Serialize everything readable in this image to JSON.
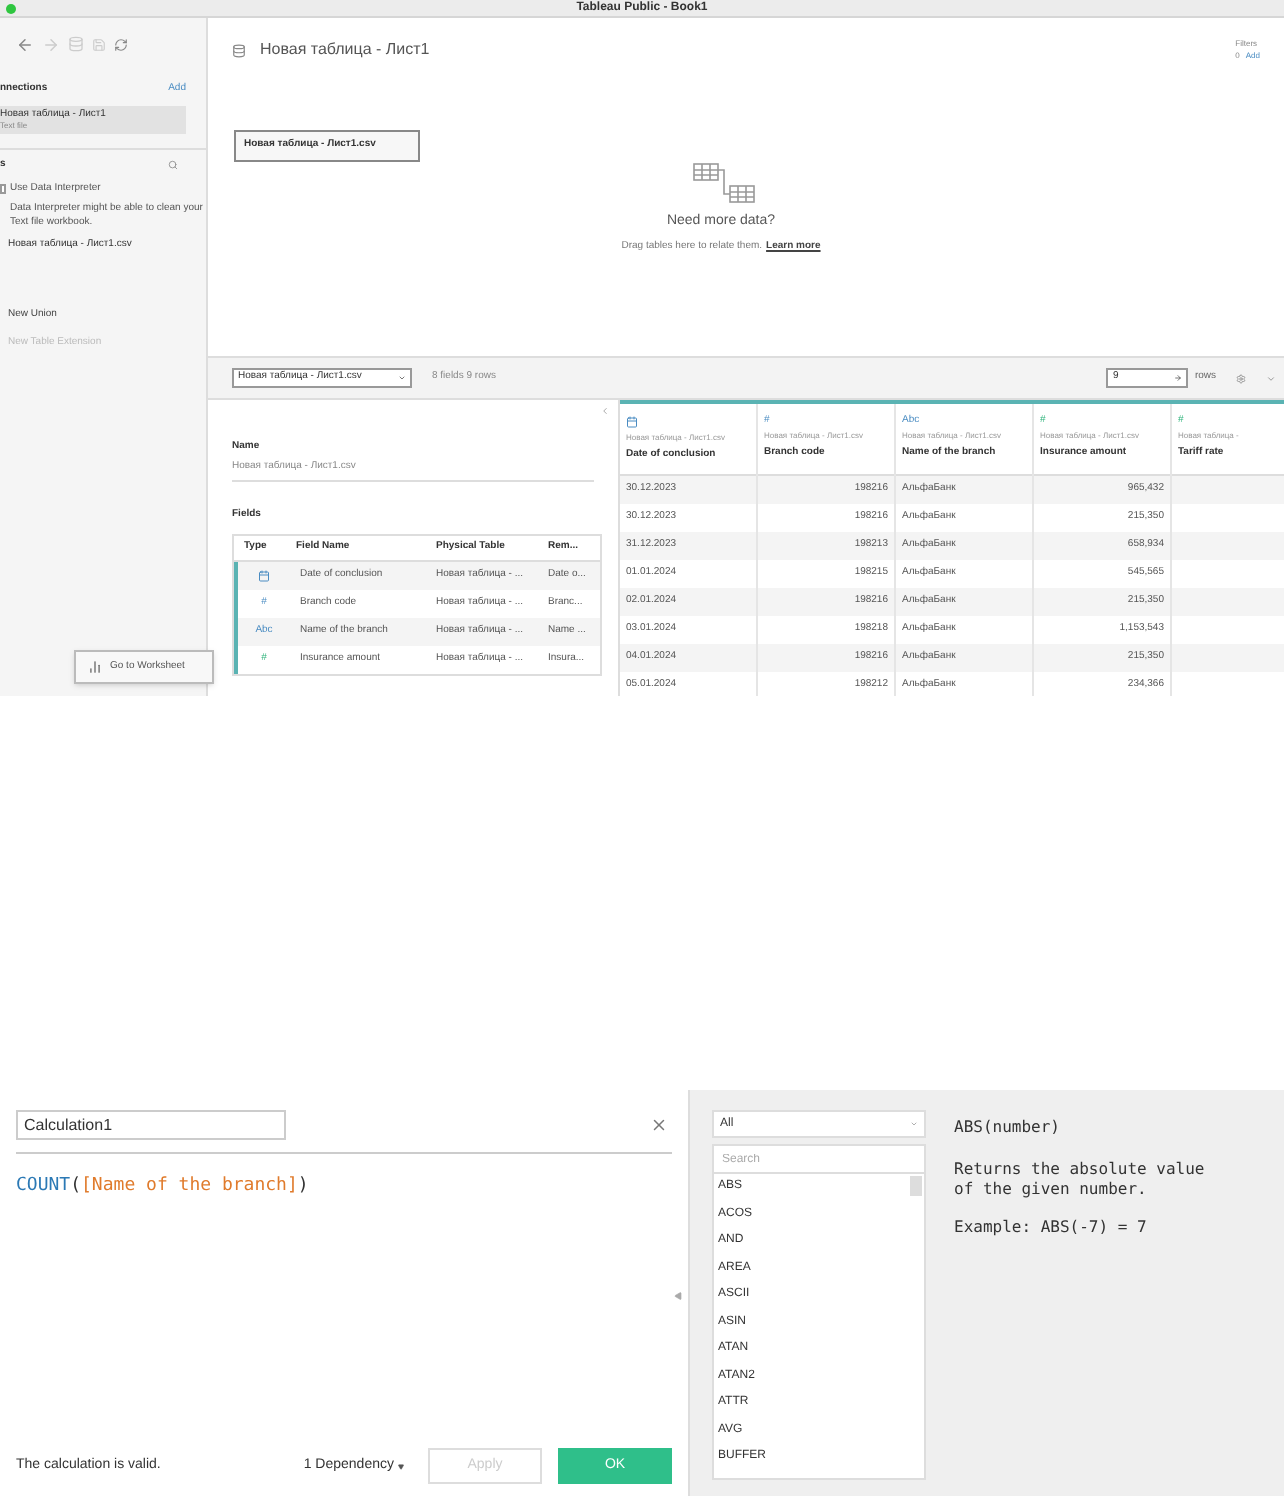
{
  "window": {
    "title": "Tableau Public - Book1"
  },
  "sidebar": {
    "connections_heading": "nnections",
    "add_link": "Add",
    "connection": {
      "name": "Новая таблица - Лист1",
      "type": "Text file"
    },
    "tables_heading": "s",
    "data_interpreter": {
      "label": "Use Data Interpreter",
      "checked": false,
      "hint": "Data Interpreter might be able to clean your Text file workbook."
    },
    "tables": [
      "Новая таблица - Лист1.csv"
    ],
    "actions": [
      {
        "label": "New Union",
        "disabled": false
      },
      {
        "label": "New Table Extension",
        "disabled": true
      }
    ]
  },
  "canvas": {
    "title": "Новая таблица - Лист1",
    "filters": {
      "label": "Filters",
      "count": "0",
      "add": "Add"
    },
    "table_box": "Новая таблица - Лист1.csv",
    "empty_title": "Need more data?",
    "empty_text": "Drag tables here to relate them.",
    "link": "Learn more"
  },
  "tooltip": {
    "label": "Go to Worksheet"
  },
  "grid_toolbar": {
    "table_select": "Новая таблица - Лист1.csv",
    "summary": "8 fields 9 rows",
    "rows_value": "9",
    "rows_label": "rows"
  },
  "metadata": {
    "name_label": "Name",
    "name_value": "Новая таблица - Лист1.csv",
    "fields_label": "Fields",
    "columns": [
      "Type",
      "Field Name",
      "Physical Table",
      "Rem..."
    ],
    "rows": [
      {
        "kind": "date",
        "field": "Date of conclusion",
        "table": "Новая таблица - ...",
        "remote": "Date o..."
      },
      {
        "kind": "number",
        "glyph": "#",
        "field": "Branch code",
        "table": "Новая таблица - ...",
        "remote": "Branc..."
      },
      {
        "kind": "string",
        "glyph": "Abc",
        "field": "Name of the branch",
        "table": "Новая таблица - ...",
        "remote": "Name ..."
      },
      {
        "kind": "measure",
        "glyph": "#",
        "field": "Insurance amount",
        "table": "Новая таблица - ...",
        "remote": "Insura..."
      }
    ]
  },
  "grid": {
    "columns": [
      {
        "kind": "date",
        "source": "Новая таблица - Лист1.csv",
        "name": "Date of conclusion"
      },
      {
        "kind": "number",
        "glyph": "#",
        "source": "Новая таблица - Лист1.csv",
        "name": "Branch code"
      },
      {
        "kind": "string",
        "glyph": "Abc",
        "source": "Новая таблица - Лист1.csv",
        "name": "Name of the branch"
      },
      {
        "kind": "measure",
        "glyph": "#",
        "source": "Новая таблица - Лист1.csv",
        "name": "Insurance amount"
      },
      {
        "kind": "measure",
        "glyph": "#",
        "source": "Новая таблица -",
        "name": "Tariff rate"
      }
    ],
    "rows": [
      [
        "30.12.2023",
        "198216",
        "АльфаБанк",
        "965,432"
      ],
      [
        "30.12.2023",
        "198216",
        "АльфаБанк",
        "215,350"
      ],
      [
        "31.12.2023",
        "198213",
        "АльфаБанк",
        "658,934"
      ],
      [
        "01.01.2024",
        "198215",
        "АльфаБанк",
        "545,565"
      ],
      [
        "02.01.2024",
        "198216",
        "АльфаБанк",
        "215,350"
      ],
      [
        "03.01.2024",
        "198218",
        "АльфаБанк",
        "1,153,543"
      ],
      [
        "04.01.2024",
        "198216",
        "АльфаБанк",
        "215,350"
      ],
      [
        "05.01.2024",
        "198212",
        "АльфаБанк",
        "234,366"
      ]
    ]
  },
  "calc": {
    "name": "Calculation1",
    "formula": {
      "function": "COUNT",
      "open": "(",
      "field": "[Name of the branch]",
      "close": ")"
    },
    "status": "The calculation is valid.",
    "dependency": "1 Dependency",
    "buttons": [
      {
        "kind": "secondary",
        "label": "Apply",
        "disabled": true
      },
      {
        "kind": "primary",
        "label": "OK",
        "disabled": false
      }
    ]
  },
  "functions": {
    "category": "All",
    "search_placeholder": "Search",
    "items": [
      "ABS",
      "ACOS",
      "AND",
      "AREA",
      "ASCII",
      "ASIN",
      "ATAN",
      "ATAN2",
      "ATTR",
      "AVG",
      "BUFFER"
    ],
    "signature": "ABS(number)",
    "description": "Returns the absolute value of the given number.",
    "example": "Example: ABS(-7) = 7"
  }
}
